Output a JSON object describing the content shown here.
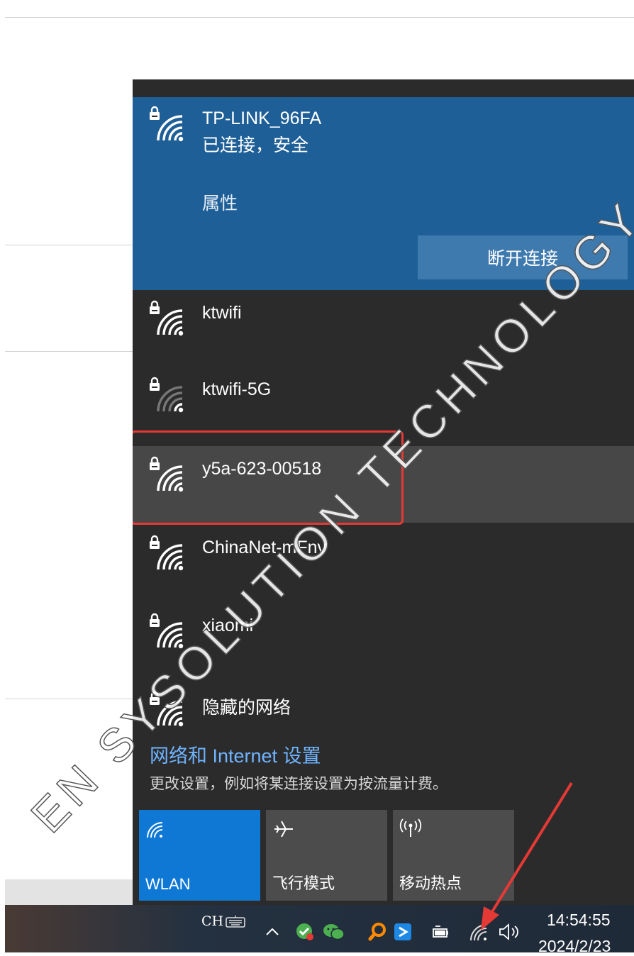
{
  "flyout": {
    "connected": {
      "name": "TP-LINK_96FA",
      "status": "已连接，安全",
      "properties": "属性",
      "disconnect": "断开连接"
    },
    "networks": [
      {
        "name": "ktwifi",
        "icon": "wifi-secured-icon"
      },
      {
        "name": "ktwifi-5G",
        "icon": "wifi-secured-icon"
      },
      {
        "name": "y5a-623-00518",
        "icon": "wifi-secured-icon"
      },
      {
        "name": "ChinaNet-mFnv",
        "icon": "wifi-secured-icon"
      },
      {
        "name": "xiaomi",
        "icon": "wifi-secured-icon"
      },
      {
        "name": "隐藏的网络",
        "icon": "wifi-secured-icon"
      }
    ],
    "settings_link": "网络和 Internet 设置",
    "settings_desc": "更改设置，例如将某连接设置为按流量计费。",
    "tiles": [
      {
        "label": "WLAN",
        "icon": "wifi-icon"
      },
      {
        "label": "飞行模式",
        "icon": "airplane-icon"
      },
      {
        "label": "移动热点",
        "icon": "hotspot-icon"
      }
    ]
  },
  "taskbar": {
    "ime": "CH",
    "time": "14:54:55",
    "date": "2024/2/23"
  },
  "watermark": "EN SYSOLUTION TECHNOLOGY",
  "colors": {
    "accent": "#1e5f98",
    "flyout_bg": "#2b2b2b",
    "tile_active": "#0f78d4",
    "highlight_box": "#e53935",
    "link": "#6fb4ff"
  }
}
